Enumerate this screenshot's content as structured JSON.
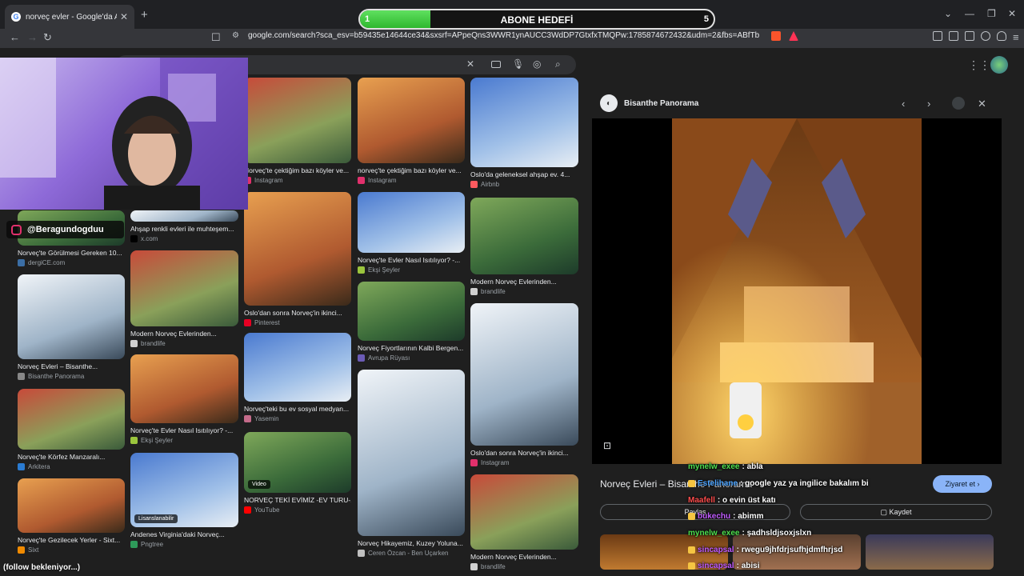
{
  "browser": {
    "tab_title": "norveç evler - Google'da Ara",
    "url": "google.com/search?sca_esv=b59435e14644ce34&sxsrf=APpeQns3WWR1ynAUCC3WdDP7GtxfxTMQPw:1785874672432&udm=2&fbs=ABfTbFWfPazdQe..."
  },
  "goal": {
    "left": "1",
    "title": "ABONE HEDEFİ",
    "target": "5",
    "progress": 0.2
  },
  "streamer_handle": "@Beragundogduu",
  "grid": {
    "col1": [
      {
        "caption": "Norveç'te Görülmesi Gereken 10...",
        "source": "dergiCE.com",
        "color": "#3b6ea5"
      },
      {
        "caption": "Norveç Evleri – Bisanthe...",
        "source": "Bisanthe Panorama",
        "color": "#888888"
      },
      {
        "caption": "Norveç'te Körfez Manzaralı...",
        "source": "Arkitera",
        "color": "#2a7bd1"
      },
      {
        "caption": "Norveç'te Gezilecek Yerler - Sixt...",
        "source": "Sixt",
        "color": "#f08a00"
      }
    ],
    "col2": [
      {
        "caption": "Ahşap renkli evleri ile muhteşem...",
        "source": "x.com",
        "color": "#000000"
      },
      {
        "caption": "Modern Norveç Evlerinden...",
        "source": "brandlife",
        "color": "#d0d0d0"
      },
      {
        "caption": "Norveç'te Evler Nasıl Isıtılıyor? -...",
        "source": "Ekşi Şeyler",
        "color": "#9bc53d"
      },
      {
        "caption": "Andenes Virginia'daki Norveç...",
        "source": "Pngtree",
        "color": "#2e9a5a",
        "tag": "Lisanslanabilir"
      }
    ],
    "col3": [
      {
        "caption": "Norveç'te çektiğim bazı köyler ve...",
        "source": "Instagram",
        "color": "#e1306c"
      },
      {
        "caption": "Oslo'dan sonra Norveç'in ikinci...",
        "source": "Pinterest",
        "color": "#e60023"
      },
      {
        "caption": "Norveç'teki bu ev sosyal medyan...",
        "source": "Yasemin",
        "color": "#c46b8a"
      },
      {
        "caption": "NORVEÇ TEKİ EVİMİZ -EV TURU-...",
        "source": "YouTube",
        "color": "#ff0000",
        "tag": "Video"
      }
    ],
    "col4": [
      {
        "caption": "norveç'te çektiğim bazı köyler ve...",
        "source": "Instagram",
        "color": "#e1306c"
      },
      {
        "caption": "Norveç'te Evler Nasıl Isıtılıyor? -...",
        "source": "Ekşi Şeyler",
        "color": "#9bc53d"
      },
      {
        "caption": "Norveç Fiyortlarının Kalbi Bergen...",
        "source": "Avrupa Rüyası",
        "color": "#6b5bb5"
      },
      {
        "caption": "Norveç Hikayemiz, Kuzey Yoluna...",
        "source": "Ceren Özcan - Ben Uçarken",
        "color": "#c0c0c0"
      }
    ],
    "col5": [
      {
        "caption": "Oslo'da geleneksel ahşap ev. 4...",
        "source": "Airbnb",
        "color": "#ff5a5f"
      },
      {
        "caption": "Modern Norveç Evlerinden...",
        "source": "brandlife",
        "color": "#d0d0d0"
      },
      {
        "caption": "Oslo'dan sonra Norveç'in ikinci...",
        "source": "Instagram",
        "color": "#e1306c"
      },
      {
        "caption": "Modern Norveç Evlerinden...",
        "source": "brandlife",
        "color": "#d0d0d0"
      }
    ]
  },
  "panel": {
    "site": "Bisanthe Panorama",
    "title": "Norveç Evleri – Bisanthe Panorama",
    "visit": "Ziyaret et",
    "share": "Paylaş",
    "save": "Kaydet"
  },
  "chat": [
    {
      "user": "mynelw_exee",
      "msg": "abla",
      "color": "#4ee04e"
    },
    {
      "user": "Estelihane",
      "msg": "google yaz ya ingilice bakalım bi",
      "color": "#4aa3ff"
    },
    {
      "user": "Maafell",
      "msg": "o evin üst katı",
      "color": "#ff4d4d"
    },
    {
      "user": "bukechu",
      "msg": "abimm",
      "color": "#c05cff"
    },
    {
      "user": "mynelw_exee",
      "msg": "şadhsldjsoxjslxn",
      "color": "#4ee04e"
    },
    {
      "user": "sincapsal",
      "msg": "rwegu9jhfdrjsufhjdmfhrjsd",
      "color": "#c05cff"
    },
    {
      "user": "sincapsal",
      "msg": "abisi",
      "color": "#c05cff"
    }
  ],
  "follow_text": "(follow bekleniyor...)"
}
